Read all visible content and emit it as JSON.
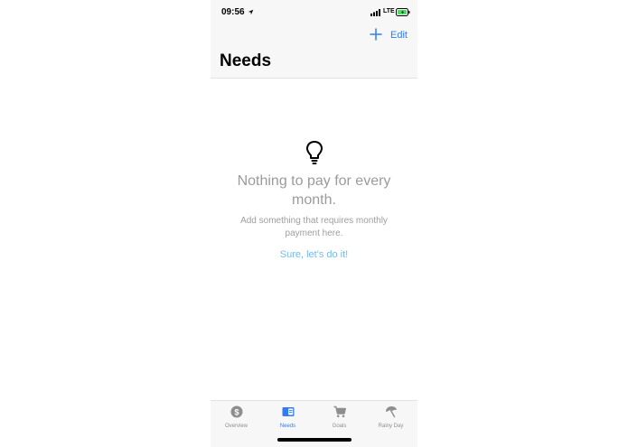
{
  "status_bar": {
    "time": "09:56",
    "network": "LTE"
  },
  "nav": {
    "add_icon": "plus-icon",
    "edit_label": "Edit",
    "title": "Needs"
  },
  "empty_state": {
    "icon": "lightbulb-icon",
    "title": "Nothing to pay for every month.",
    "subtitle": "Add something that requires monthly payment here.",
    "cta": "Sure, let's do it!"
  },
  "tabs": [
    {
      "label": "Overview",
      "icon": "dollar-coin-icon",
      "active": false
    },
    {
      "label": "Needs",
      "icon": "book-icon",
      "active": true
    },
    {
      "label": "Goals",
      "icon": "cart-icon",
      "active": false
    },
    {
      "label": "Rainy Day",
      "icon": "umbrella-icon",
      "active": false
    }
  ],
  "colors": {
    "accent": "#2f7cf6",
    "link": "#72bbf0",
    "muted_text": "#9b9b9b",
    "bar_bg": "#f7f7f7"
  }
}
